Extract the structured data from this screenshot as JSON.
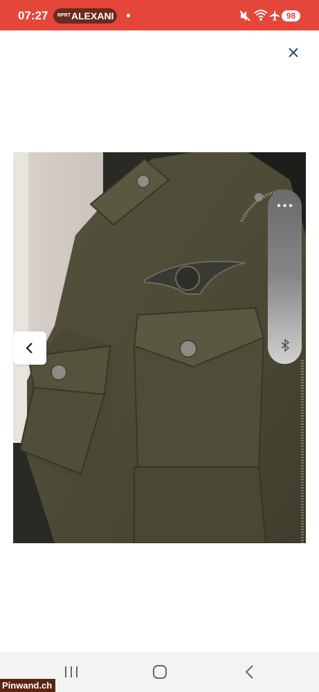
{
  "status_bar": {
    "time": "07:27",
    "notification_badge": "RPRT",
    "notification_name": "ALEXANI",
    "battery": "98",
    "icons": [
      "mute-icon",
      "wifi-icon",
      "airplane-icon"
    ],
    "color": "#e4463a"
  },
  "viewer": {
    "close_icon": "close-icon",
    "prev_icon": "chevron-left-icon",
    "image_description_colors": {
      "jacket": "#4e4c37",
      "background": "#ffffff"
    },
    "side_panel": {
      "menu_icon": "more-horizontal-icon",
      "bluetooth_icon": "bluetooth-icon"
    }
  },
  "nav_bar": {
    "recents_icon": "recents-icon",
    "home_icon": "home-icon",
    "back_icon": "back-icon"
  },
  "watermark": "Pinwand.ch"
}
